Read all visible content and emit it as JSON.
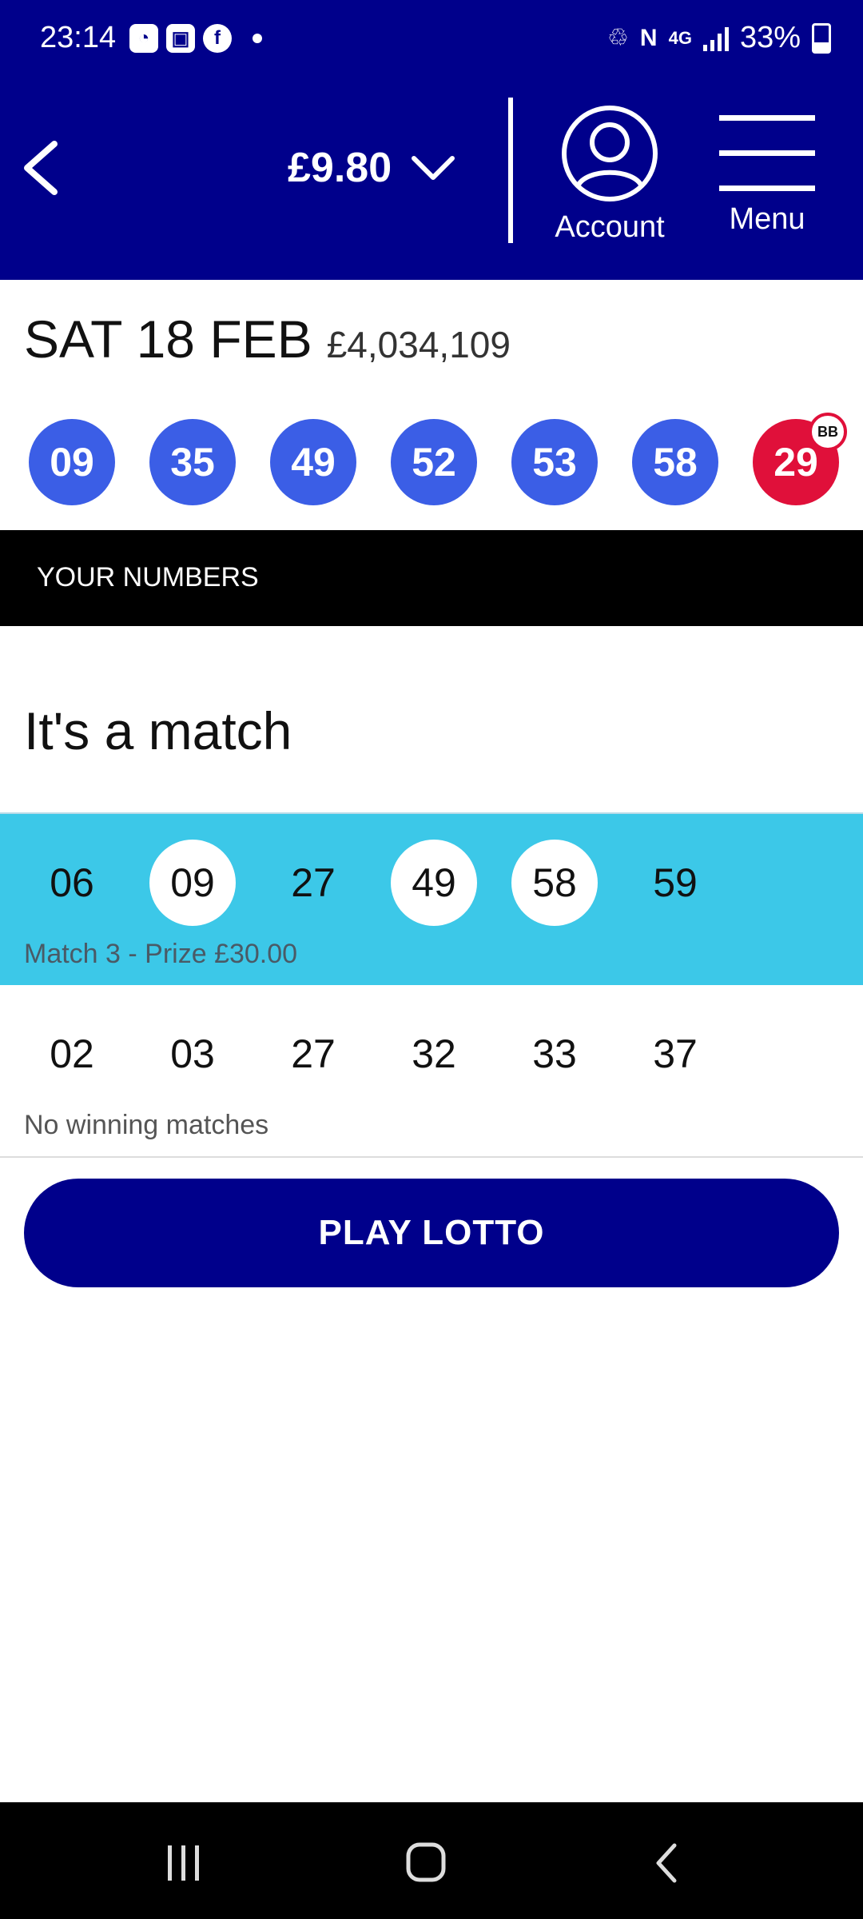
{
  "status_bar": {
    "time": "23:14",
    "network": "4G",
    "battery": "33%"
  },
  "header": {
    "balance": "£9.80",
    "account_label": "Account",
    "menu_label": "Menu"
  },
  "draw": {
    "date": "SAT 18 FEB",
    "jackpot": "£4,034,109",
    "balls": [
      "09",
      "35",
      "49",
      "52",
      "53",
      "58"
    ],
    "bonus_ball": "29",
    "bonus_badge": "BB"
  },
  "section": {
    "title": "YOUR NUMBERS"
  },
  "result": {
    "heading": "It's a match"
  },
  "lines": [
    {
      "numbers": [
        "06",
        "09",
        "27",
        "49",
        "58",
        "59"
      ],
      "matched": [
        false,
        true,
        false,
        true,
        true,
        false
      ],
      "status": "Match 3 - Prize £30.00"
    },
    {
      "numbers": [
        "02",
        "03",
        "27",
        "32",
        "33",
        "37"
      ],
      "matched": [
        false,
        false,
        false,
        false,
        false,
        false
      ],
      "status": "No winning matches"
    }
  ],
  "cta": {
    "label": "PLAY LOTTO"
  },
  "colors": {
    "brand_navy": "#00008b",
    "ball_blue": "#3b5ee6",
    "bonus_red": "#e0103a",
    "match_highlight": "#3cc8e8"
  }
}
